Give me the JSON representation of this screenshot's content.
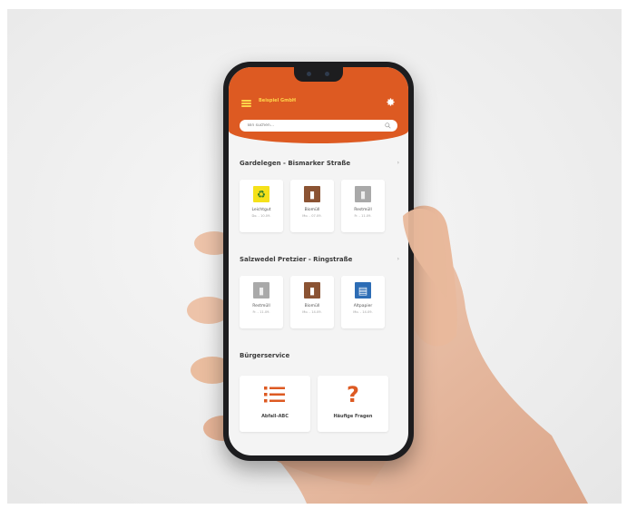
{
  "app": {
    "title": "Beispiel GmbH",
    "accent_color": "#dd5a22",
    "title_color": "#ffd44a"
  },
  "search": {
    "placeholder": "Bin suchen...",
    "icon": "search-icon"
  },
  "locations": [
    {
      "title": "Gardelegen - Bismarker Straße",
      "cards": [
        {
          "label": "Leichtgut",
          "date": "Do. - 10.09.",
          "icon": "recycle-icon",
          "color": "#f5e11a"
        },
        {
          "label": "Biomüll",
          "date": "Mo. - 07.09.",
          "icon": "bin-icon",
          "color": "#8b5333"
        },
        {
          "label": "Restmüll",
          "date": "Fr. - 11.09.",
          "icon": "bin-icon",
          "color": "#a9a9a9"
        }
      ]
    },
    {
      "title": "Salzwedel Pretzier - Ringstraße",
      "cards": [
        {
          "label": "Restmüll",
          "date": "Fr. - 11.09.",
          "icon": "bin-icon",
          "color": "#a9a9a9"
        },
        {
          "label": "Biomüll",
          "date": "Mo. - 14.09.",
          "icon": "bin-icon",
          "color": "#8b5333"
        },
        {
          "label": "Altpapier",
          "date": "Mo. - 14.09.",
          "icon": "paper-bin-icon",
          "color": "#2d6db5"
        }
      ]
    }
  ],
  "service": {
    "title": "Bürgerservice",
    "items": [
      {
        "label": "Abfall-ABC",
        "icon": "list-icon"
      },
      {
        "label": "Häufige Fragen",
        "icon": "question-icon"
      }
    ]
  }
}
